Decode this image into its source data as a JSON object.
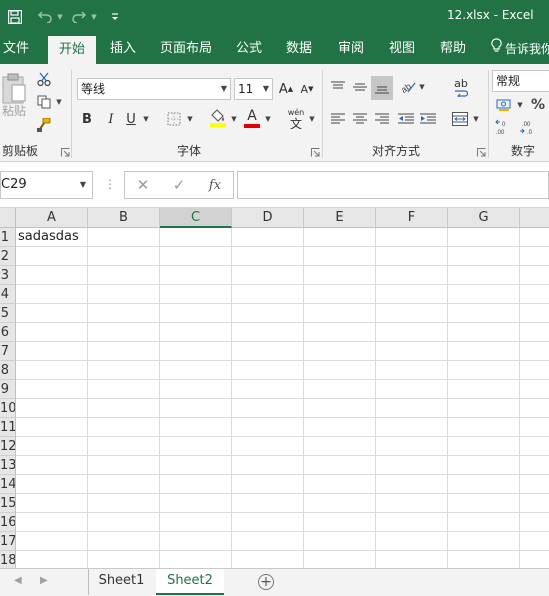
{
  "window": {
    "title": "12.xlsx  -  Excel"
  },
  "quick_access": {
    "items": [
      "save-icon",
      "undo-icon",
      "redo-icon",
      "customize-icon"
    ]
  },
  "ribbon_tabs": [
    "文件",
    "开始",
    "插入",
    "页面布局",
    "公式",
    "数据",
    "审阅",
    "视图",
    "帮助",
    "告诉我你"
  ],
  "active_tab": "开始",
  "ribbon": {
    "clipboard": {
      "paste_label": "粘贴",
      "group_label": "剪贴板"
    },
    "font": {
      "name": "等线",
      "size": "11",
      "group_label": "字体",
      "bold": "B",
      "italic": "I",
      "underline": "U",
      "grow": "A",
      "shrink": "A",
      "wen": "wén",
      "wen_char": "文",
      "font_color_letter": "A"
    },
    "alignment": {
      "group_label": "对齐方式",
      "wrap_label": "ab"
    },
    "number": {
      "format": "常规",
      "group_label": "数字",
      "percent": "%"
    }
  },
  "formula_bar": {
    "name_box": "C29",
    "fx": "fx",
    "value": ""
  },
  "columns": [
    "A",
    "B",
    "C",
    "D",
    "E",
    "F",
    "G"
  ],
  "selected_column": "C",
  "rows": [
    "1",
    "2",
    "3",
    "4",
    "5",
    "6",
    "7",
    "8",
    "9",
    "10",
    "11",
    "12",
    "13",
    "14",
    "15",
    "16",
    "17",
    "18"
  ],
  "cells": {
    "A1": "sadasdas"
  },
  "sheets": [
    "Sheet1",
    "Sheet2"
  ],
  "active_sheet": "Sheet2",
  "colors": {
    "accent": "#217346",
    "ribbon_bg": "#f3f3f3",
    "header_bg": "#e6e6e6",
    "font_color_bar": "#e00000",
    "fill_color_bar": "#ffff00"
  }
}
